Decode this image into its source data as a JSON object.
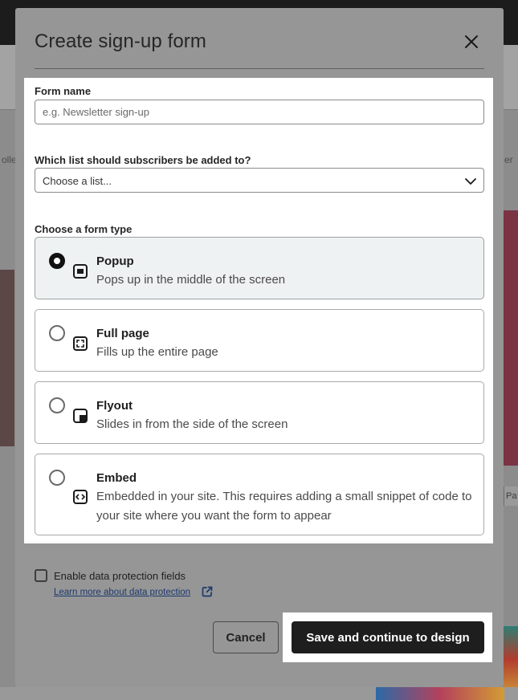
{
  "background": {
    "left_word": "olle",
    "right_word": "er",
    "right_tag": "Pa"
  },
  "modal": {
    "title": "Create sign-up form",
    "close_icon": "close-icon"
  },
  "form_name": {
    "label": "Form name",
    "value": "",
    "placeholder": "e.g. Newsletter sign-up"
  },
  "list_select": {
    "label": "Which list should subscribers be added to?",
    "selected": "Choose a list...",
    "icon": "chevron-down-icon"
  },
  "form_type": {
    "label": "Choose a form type",
    "selected": "Popup",
    "options": [
      {
        "title": "Popup",
        "description": "Pops up in the middle of the screen",
        "icon": "popup-icon",
        "checked": true
      },
      {
        "title": "Full page",
        "description": "Fills up the entire page",
        "icon": "full-page-icon",
        "checked": false
      },
      {
        "title": "Flyout",
        "description": "Slides in from the side of the screen",
        "icon": "flyout-icon",
        "checked": false
      },
      {
        "title": "Embed",
        "description": "Embedded in your site. This requires adding a small snippet of code to your site where you want the form to appear",
        "icon": "embed-icon",
        "checked": false
      }
    ]
  },
  "data_protection": {
    "checkbox_label": "Enable data protection fields",
    "checked": false,
    "learn_more": "Learn more about data protection",
    "link_icon": "external-link-icon"
  },
  "actions": {
    "cancel_label": "Cancel",
    "save_label": "Save and continue to design"
  },
  "colors": {
    "primary_button": "#1e1e1e",
    "link": "#1d3a6e",
    "selected_card": "#eff2f2",
    "overlay": "#969696"
  }
}
